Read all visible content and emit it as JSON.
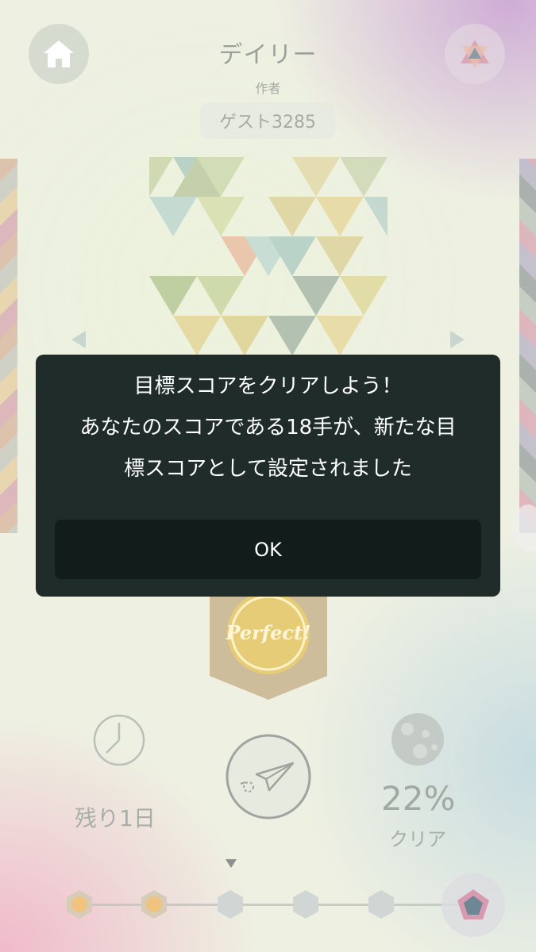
{
  "header": {
    "title": "デイリー",
    "author_label": "作者",
    "author_name": "ゲスト3285"
  },
  "badge": {
    "label": "Perfect!"
  },
  "stats": {
    "remaining": "残り1日",
    "clear_percent": "22%",
    "clear_label": "クリア"
  },
  "progress": {
    "nodes": [
      "completed",
      "completed",
      "locked",
      "locked",
      "locked"
    ],
    "final_icon": "pentagon-gem-icon"
  },
  "dialog": {
    "line1": "目標スコアをクリアしよう！",
    "line2": "あなたのスコアである18手が、新たな目",
    "line3": "標スコアとして設定されました",
    "ok_label": "OK"
  },
  "colors": {
    "dialog_bg": "#1f2c29",
    "ok_button_bg": "#121d1b",
    "node_completed": "#f0c37e",
    "node_locked": "#cfd6d3",
    "badge_gold": "#efcd74"
  },
  "icons": [
    "home-icon",
    "triangle-menu-icon",
    "clock-icon",
    "paper-plane-icon",
    "moon-icon",
    "pentagon-gem-icon"
  ]
}
